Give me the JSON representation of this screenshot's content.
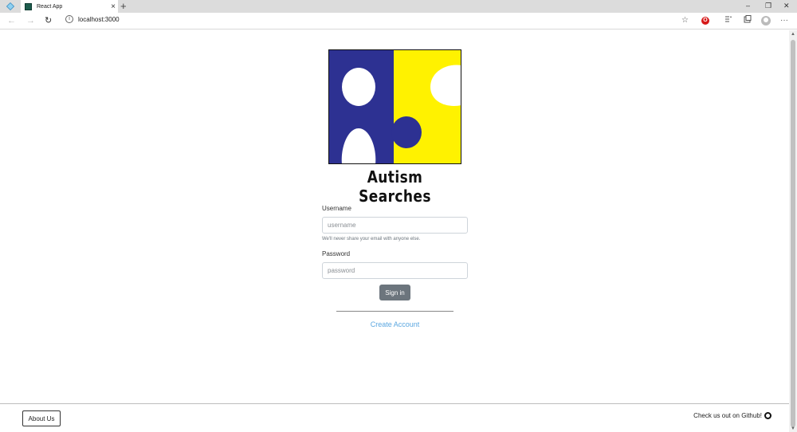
{
  "browser": {
    "tab_title": "React App",
    "tab_close": "×",
    "new_tab": "+",
    "address": "localhost:3000",
    "info_glyph": "i",
    "back_glyph": "←",
    "forward_glyph": "→",
    "reload_glyph": "↻",
    "star_glyph": "☆",
    "menu_glyph": "···",
    "minimize_glyph": "–",
    "restore_glyph": "❐",
    "close_glyph": "✕"
  },
  "brand": {
    "name": "Autism Searches",
    "colors": {
      "blue": "#2d3192",
      "yellow": "#fff200"
    }
  },
  "form": {
    "username_label": "Username",
    "username_placeholder": "username",
    "username_hint": "We'll never share your email with anyone else.",
    "password_label": "Password",
    "password_placeholder": "password",
    "signin_label": "Sign in",
    "create_account": "Create Account"
  },
  "footer": {
    "about_label": "About Us",
    "github_text": "Check us out on Github!"
  }
}
